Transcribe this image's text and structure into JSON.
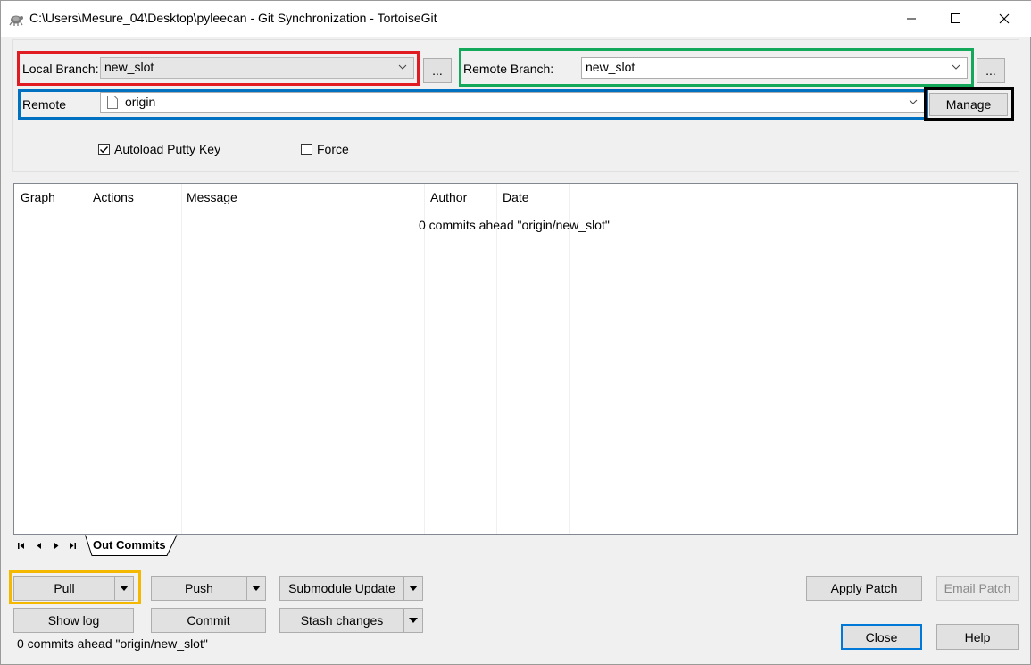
{
  "window": {
    "title": "C:\\Users\\Mesure_04\\Desktop\\pyleecan - Git Synchronization - TortoiseGit",
    "controls": {
      "minimize_icon": "minimize-icon",
      "maximize_icon": "maximize-icon",
      "close_icon": "close-icon"
    }
  },
  "local_branch": {
    "label": "Local Branch:",
    "value": "new_slot",
    "browse_label": "..."
  },
  "remote_branch": {
    "label": "Remote Branch:",
    "value": "new_slot",
    "browse_label": "..."
  },
  "remote": {
    "label": "Remote",
    "value": "origin",
    "manage_label": "Manage"
  },
  "options": {
    "autoload_putty": {
      "label": "Autoload Putty Key",
      "checked": true
    },
    "force": {
      "label": "Force",
      "checked": false
    }
  },
  "commit_list": {
    "columns": [
      "Graph",
      "Actions",
      "Message",
      "Author",
      "Date"
    ],
    "empty_message": "0 commits ahead \"origin/new_slot\""
  },
  "tabs": {
    "active": "Out Commits",
    "nav_icons": [
      "first-icon",
      "prev-icon",
      "next-icon",
      "last-icon"
    ]
  },
  "buttons": {
    "pull": "Pull",
    "push": "Push",
    "submodule_update": "Submodule Update",
    "show_log": "Show log",
    "commit": "Commit",
    "stash_changes": "Stash changes",
    "apply_patch": "Apply Patch",
    "email_patch": "Email Patch",
    "close": "Close",
    "help": "Help"
  },
  "status": {
    "text": "0 commits ahead \"origin/new_slot\""
  },
  "colors": {
    "highlight_local": "#e11b22",
    "highlight_remote_branch": "#14a85a",
    "highlight_remote": "#0070c0",
    "highlight_manage": "#000000",
    "highlight_pull": "#f5b800"
  }
}
